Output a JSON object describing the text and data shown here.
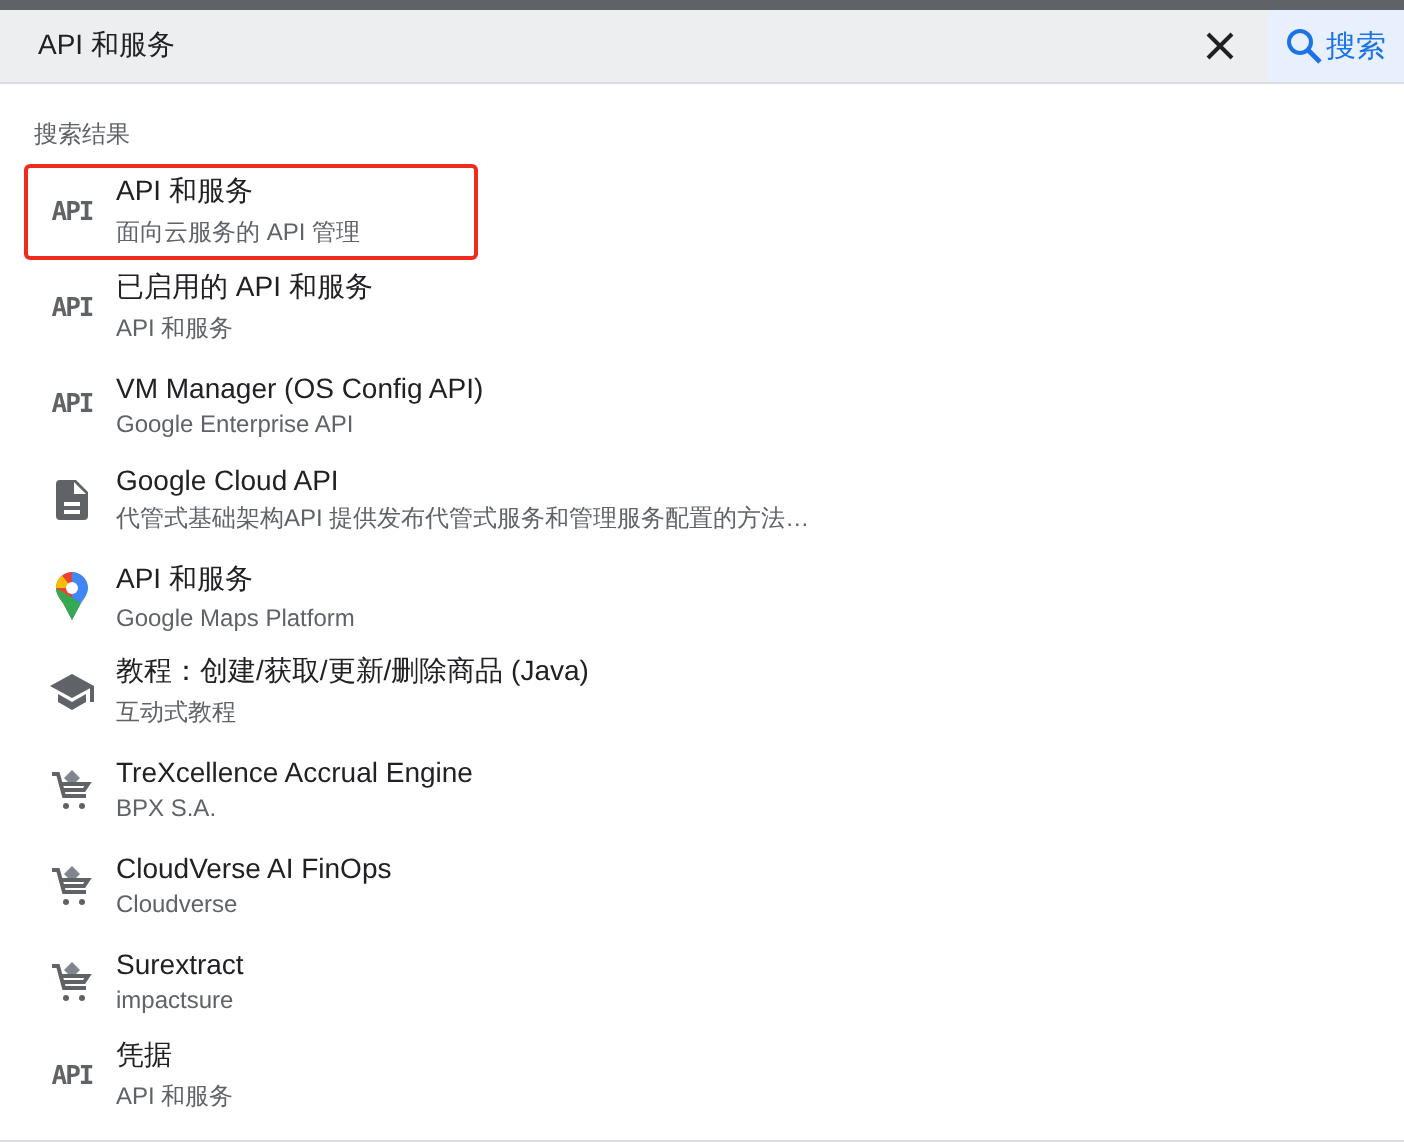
{
  "search": {
    "value": "API 和服务",
    "button": "搜索"
  },
  "section_title": "搜索结果",
  "results": [
    {
      "kind": "api",
      "icon_text": "API",
      "title": "API 和服务",
      "subtitle": "面向云服务的 API 管理",
      "highlighted": true
    },
    {
      "kind": "api",
      "icon_text": "API",
      "title": "已启用的 API 和服务",
      "subtitle": "API 和服务",
      "highlighted": false
    },
    {
      "kind": "api",
      "icon_text": "API",
      "title": "VM Manager (OS Config API)",
      "subtitle": "Google Enterprise API",
      "highlighted": false
    },
    {
      "kind": "doc",
      "title": "Google Cloud API",
      "subtitle": "代管式基础架构API 提供发布代管式服务和管理服务配置的方法…",
      "highlighted": false
    },
    {
      "kind": "maps",
      "title": "API 和服务",
      "subtitle": "Google Maps Platform",
      "highlighted": false
    },
    {
      "kind": "school",
      "title": "教程：创建/获取/更新/删除商品 (Java)",
      "subtitle": "互动式教程",
      "highlighted": false
    },
    {
      "kind": "cart",
      "title": "TreXcellence Accrual Engine",
      "subtitle": "BPX S.A.",
      "highlighted": false
    },
    {
      "kind": "cart",
      "title": "CloudVerse AI FinOps",
      "subtitle": "Cloudverse",
      "highlighted": false
    },
    {
      "kind": "cart",
      "title": "Surextract",
      "subtitle": "impactsure",
      "highlighted": false
    },
    {
      "kind": "api",
      "icon_text": "API",
      "title": "凭据",
      "subtitle": "API 和服务",
      "highlighted": false
    }
  ]
}
